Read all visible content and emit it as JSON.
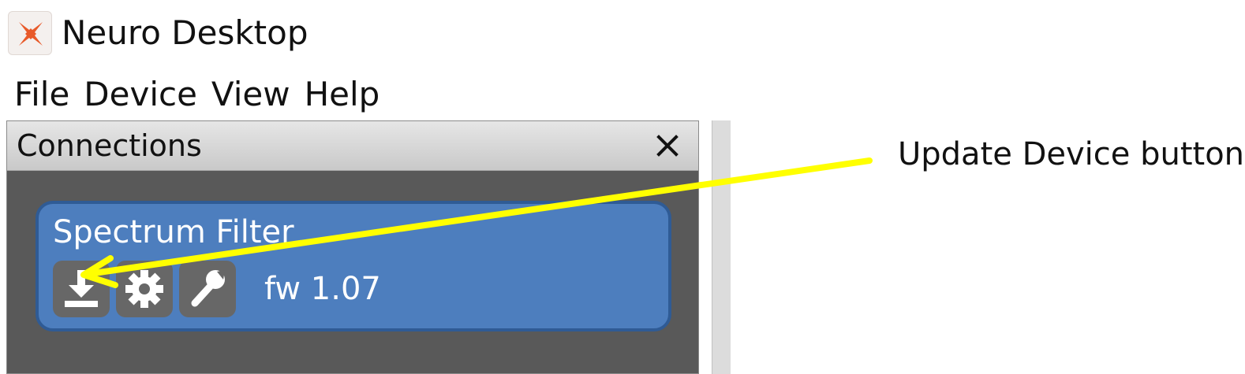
{
  "app": {
    "title": "Neuro Desktop",
    "icon": "neuro-logo-icon",
    "accent_color": "#e85a2a"
  },
  "menu": {
    "items": [
      "File",
      "Device",
      "View",
      "Help"
    ]
  },
  "connections_panel": {
    "title": "Connections",
    "close_icon": "close-icon",
    "background_color": "#595959",
    "device": {
      "name": "Spectrum Filter",
      "firmware": "fw 1.07",
      "card_color": "#4d7ebe",
      "buttons": [
        {
          "icon": "download-icon",
          "action": "update-device"
        },
        {
          "icon": "gear-icon",
          "action": "settings"
        },
        {
          "icon": "wrench-icon",
          "action": "tools"
        }
      ]
    }
  },
  "annotation": {
    "label": "Update Device button",
    "arrow_color": "#ffff00"
  }
}
